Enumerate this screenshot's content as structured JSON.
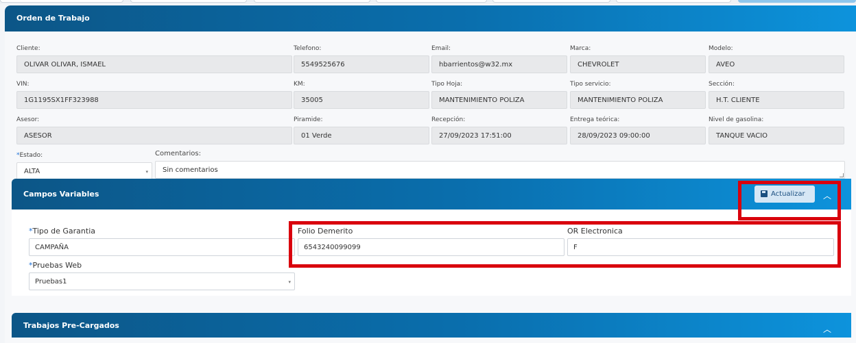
{
  "header": {
    "title": "Orden de Trabajo"
  },
  "fields": {
    "cliente": {
      "label": "Cliente:",
      "value": "OLIVAR OLIVAR, ISMAEL"
    },
    "telefono": {
      "label": "Telefono:",
      "value": "5549525676"
    },
    "email": {
      "label": "Email:",
      "value": "hbarrientos@w32.mx"
    },
    "marca": {
      "label": "Marca:",
      "value": "CHEVROLET"
    },
    "modelo": {
      "label": "Modelo:",
      "value": "AVEO"
    },
    "vin": {
      "label": "VIN:",
      "value": "1G1195SX1FF323988"
    },
    "km": {
      "label": "KM:",
      "value": "35005"
    },
    "tipo_hoja": {
      "label": "Tipo Hoja:",
      "value": "MANTENIMIENTO POLIZA"
    },
    "tipo_servicio": {
      "label": "Tipo servicio:",
      "value": "MANTENIMIENTO POLIZA"
    },
    "seccion": {
      "label": "Sección:",
      "value": "H.T. CLIENTE"
    },
    "asesor": {
      "label": "Asesor:",
      "value": "ASESOR"
    },
    "piramide": {
      "label": "Piramide:",
      "value": "01 Verde"
    },
    "recepcion": {
      "label": "Recepción:",
      "value": "27/09/2023 17:51:00"
    },
    "entrega": {
      "label": "Entrega teórica:",
      "value": "28/09/2023 09:00:00"
    },
    "gasolina": {
      "label": "Nivel de gasolina:",
      "value": "TANQUE VACIO"
    },
    "estado": {
      "required_mark": "*",
      "label": "Estado:",
      "value": "ALTA"
    },
    "comentarios": {
      "label": "Comentarios:",
      "value": "Sin comentarios"
    }
  },
  "campos_variables": {
    "title": "Campos Variables",
    "update_label": "Actualizar",
    "tipo_garantia": {
      "required_mark": "*",
      "label": "Tipo de Garantia",
      "value": "CAMPAÑA"
    },
    "folio_demerito": {
      "label": "Folio Demerito",
      "value": "6543240099099"
    },
    "or_electronica": {
      "label": "OR Electronica",
      "value": "F"
    },
    "pruebas_web": {
      "required_mark": "*",
      "label": "Pruebas Web",
      "value": "Pruebas1"
    }
  },
  "trabajos": {
    "title": "Trabajos Pre-Cargados"
  },
  "icons": {
    "caret": "▾",
    "chevron_up": "︿"
  },
  "colors": {
    "header_start": "#0c5687",
    "header_end": "#0d93dc",
    "highlight": "#d9000d"
  }
}
